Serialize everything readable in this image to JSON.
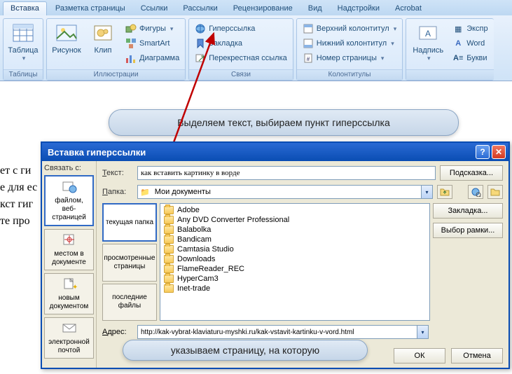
{
  "ribbon": {
    "tabs": [
      "Вставка",
      "Разметка страницы",
      "Ссылки",
      "Рассылки",
      "Рецензирование",
      "Вид",
      "Надстройки",
      "Acrobat"
    ],
    "active_tab": 0,
    "groups": {
      "tables": {
        "label": "Таблицы",
        "table": "Таблица"
      },
      "illustrations": {
        "label": "Иллюстрации",
        "picture": "Рисунок",
        "clip": "Клип",
        "shapes": "Фигуры",
        "smartart": "SmartArt",
        "chart": "Диаграмма"
      },
      "links": {
        "label": "Связи",
        "hyperlink": "Гиперссылка",
        "bookmark": "Закладка",
        "crossref": "Перекрестная ссылка"
      },
      "headerfooter": {
        "label": "Колонтитулы",
        "header": "Верхний колонтитул",
        "footer": "Нижний колонтитул",
        "pagenum": "Номер страницы"
      },
      "text": {
        "label": "",
        "textbox": "Надпись",
        "express": "Экспр",
        "wordart": "Word",
        "dropcap": "Букви"
      }
    }
  },
  "callouts": {
    "top": "Выделяем текст, выбираем пункт гиперссылка",
    "bottom": "указываем страницу, на которую"
  },
  "doc_lines": [
    "ет с ги",
    "е для ес",
    "кст гиг",
    "те про"
  ],
  "dialog": {
    "title": "Вставка гиперссылки",
    "linkto_label": "Связать с:",
    "link_targets": {
      "file": "файлом, веб-страницей",
      "place": "местом в документе",
      "newdoc": "новым документом",
      "email": "электронной почтой"
    },
    "text_label": "Текст:",
    "text_value": "как вставить картинку в ворде",
    "tooltip_btn": "Подсказка...",
    "folder_label": "Папка:",
    "folder_value": "Мои документы",
    "lookin": {
      "current": "текущая папка",
      "browsed": "просмотренные страницы",
      "recent": "последние файлы"
    },
    "files": [
      "Adobe",
      "Any DVD Converter Professional",
      "Balabolka",
      "Bandicam",
      "Camtasia Studio",
      "Downloads",
      "FlameReader_REC",
      "HyperCam3",
      "Inet-trade"
    ],
    "bookmark_btn": "Закладка...",
    "frame_btn": "Выбор рамки...",
    "address_label": "Адрес:",
    "address_value": "http://kak-vybrat-klaviaturu-myshki.ru/kak-vstavit-kartinku-v-vord.html",
    "ok": "ОК",
    "cancel": "Отмена"
  }
}
